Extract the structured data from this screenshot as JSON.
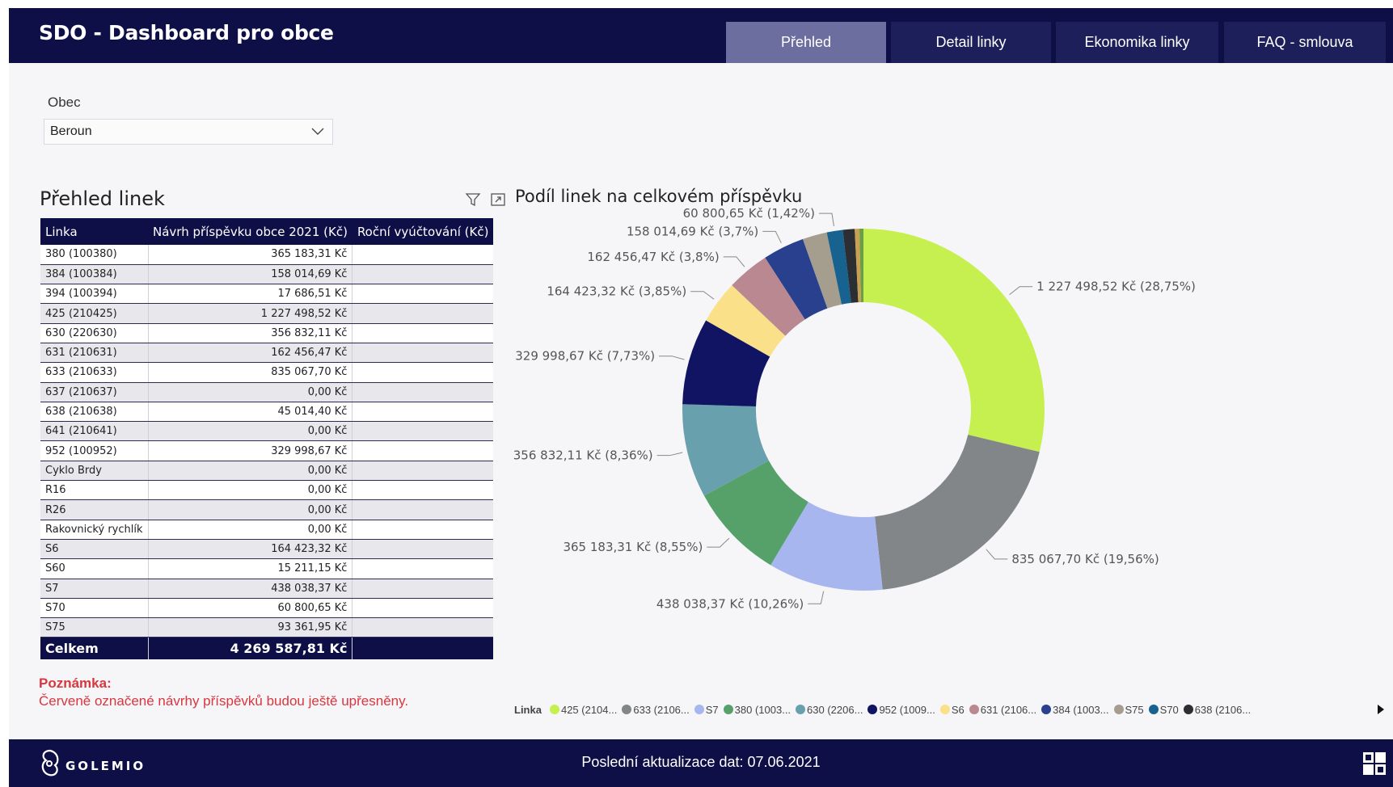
{
  "header": {
    "title": "SDO - Dashboard pro obce",
    "tabs": [
      {
        "label": "Přehled",
        "active": true
      },
      {
        "label": "Detail linky",
        "active": false
      },
      {
        "label": "Ekonomika linky",
        "active": false
      },
      {
        "label": "FAQ - smlouva",
        "active": false
      }
    ]
  },
  "filter": {
    "label": "Obec",
    "value": "Beroun"
  },
  "table_section": {
    "title": "Přehled linek",
    "columns": [
      "Linka",
      "Návrh příspěvku obce 2021 (Kč)",
      "Roční vyúčtování (Kč)"
    ],
    "rows": [
      {
        "linka": "380 (100380)",
        "navrh": "365 183,31 Kč",
        "vyuctovani": ""
      },
      {
        "linka": "384 (100384)",
        "navrh": "158 014,69 Kč",
        "vyuctovani": ""
      },
      {
        "linka": "394 (100394)",
        "navrh": "17 686,51 Kč",
        "vyuctovani": ""
      },
      {
        "linka": "425 (210425)",
        "navrh": "1 227 498,52 Kč",
        "vyuctovani": ""
      },
      {
        "linka": "630 (220630)",
        "navrh": "356 832,11 Kč",
        "vyuctovani": ""
      },
      {
        "linka": "631 (210631)",
        "navrh": "162 456,47 Kč",
        "vyuctovani": ""
      },
      {
        "linka": "633 (210633)",
        "navrh": "835 067,70 Kč",
        "vyuctovani": ""
      },
      {
        "linka": "637 (210637)",
        "navrh": "0,00 Kč",
        "vyuctovani": ""
      },
      {
        "linka": "638 (210638)",
        "navrh": "45 014,40 Kč",
        "vyuctovani": ""
      },
      {
        "linka": "641 (210641)",
        "navrh": "0,00 Kč",
        "vyuctovani": ""
      },
      {
        "linka": "952 (100952)",
        "navrh": "329 998,67 Kč",
        "vyuctovani": ""
      },
      {
        "linka": "Cyklo Brdy",
        "navrh": "0,00 Kč",
        "vyuctovani": ""
      },
      {
        "linka": "R16",
        "navrh": "0,00 Kč",
        "vyuctovani": ""
      },
      {
        "linka": "R26",
        "navrh": "0,00 Kč",
        "vyuctovani": ""
      },
      {
        "linka": "Rakovnický rychlík",
        "navrh": "0,00 Kč",
        "vyuctovani": ""
      },
      {
        "linka": "S6",
        "navrh": "164 423,32 Kč",
        "vyuctovani": ""
      },
      {
        "linka": "S60",
        "navrh": "15 211,15 Kč",
        "vyuctovani": ""
      },
      {
        "linka": "S7",
        "navrh": "438 038,37 Kč",
        "vyuctovani": ""
      },
      {
        "linka": "S70",
        "navrh": "60 800,65 Kč",
        "vyuctovani": ""
      },
      {
        "linka": "S75",
        "navrh": "93 361,95 Kč",
        "vyuctovani": ""
      }
    ],
    "total_label": "Celkem",
    "total_value": "4 269 587,81 Kč"
  },
  "note": {
    "title": "Poznámka:",
    "text": "Červeně označené návrhy příspěvků budou ještě upřesněny."
  },
  "chart_section": {
    "title": "Podíl linek na celkovém příspěvku"
  },
  "chart_data": {
    "type": "pie",
    "title": "Podíl linek na celkovém příspěvku",
    "donut": true,
    "legend_title": "Linka",
    "legend_placement": "bottom",
    "slices": [
      {
        "legend": "425 (2104...",
        "value": 1227498.52,
        "label": "1 227 498,52 Kč (28,75%)",
        "color": "#c5f04f"
      },
      {
        "legend": "633 (2106...",
        "value": 835067.7,
        "label": "835 067,70 Kč (19,56%)",
        "color": "#828688"
      },
      {
        "legend": "S7",
        "value": 438038.37,
        "label": "438 038,37 Kč (10,26%)",
        "color": "#a8b6ef"
      },
      {
        "legend": "380 (1003...",
        "value": 365183.31,
        "label": "365 183,31 Kč (8,55%)",
        "color": "#56a06a"
      },
      {
        "legend": "630 (2206...",
        "value": 356832.11,
        "label": "356 832,11 Kč (8,36%)",
        "color": "#69a0ad"
      },
      {
        "legend": "952 (1009...",
        "value": 329998.67,
        "label": "329 998,67 Kč (7,73%)",
        "color": "#111463"
      },
      {
        "legend": "S6",
        "value": 164423.32,
        "label": "164 423,32 Kč (3,85%)",
        "color": "#fbe08a"
      },
      {
        "legend": "631 (2106...",
        "value": 162456.47,
        "label": "162 456,47 Kč (3,8%)",
        "color": "#b98890"
      },
      {
        "legend": "384 (1003...",
        "value": 158014.69,
        "label": "158 014,69 Kč (3,7%)",
        "color": "#28408e"
      },
      {
        "legend": "S75",
        "value": 93361.95,
        "label": "",
        "color": "#a59e8f"
      },
      {
        "legend": "S70",
        "value": 60800.65,
        "label": "60 800,65 Kč (1,42%)",
        "color": "#17628e"
      },
      {
        "legend": "638 (2106...",
        "value": 45014.4,
        "label": "",
        "color": "#2b2e33"
      },
      {
        "legend": "",
        "value": 17686.51,
        "label": "",
        "color": "#c8a04f"
      },
      {
        "legend": "",
        "value": 15211.15,
        "label": "",
        "color": "#6a9f48"
      }
    ]
  },
  "footer": {
    "logo_text": "GOLEMIO",
    "update_text": "Poslední aktualizace dat: 07.06.2021"
  }
}
